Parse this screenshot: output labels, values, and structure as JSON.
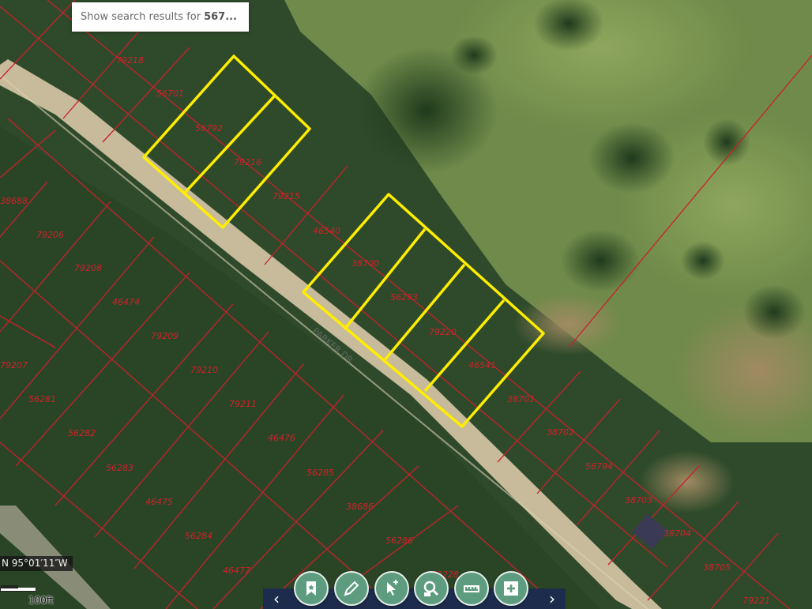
{
  "search_popup": {
    "prefix": "Show search results for",
    "query": "567..."
  },
  "coordinate_readout": "N 95°01′11″W",
  "scale_label": "100ft",
  "road_label": "PARKER DR",
  "parcel_labels": [
    "79218",
    "56701",
    "56792",
    "79216",
    "79215",
    "46540",
    "38700",
    "56293",
    "79220",
    "46541",
    "38701",
    "38702",
    "56794",
    "38703",
    "38704",
    "38705",
    "79221",
    "38688",
    "79206",
    "79208",
    "46474",
    "79209",
    "79207",
    "79210",
    "56281",
    "79211",
    "56282",
    "46476",
    "56283",
    "56285",
    "46475",
    "38686",
    "56284",
    "56286",
    "46477",
    "79228"
  ],
  "highlighted_groups": 2,
  "colors": {
    "parcel_line": "#c8202a",
    "highlight": "#ffee00",
    "toolbar": "#1d2c4d",
    "tool_button": "#5d9c7f"
  },
  "toolbar": {
    "prev": "‹",
    "next": "›",
    "buttons": [
      "bookmark-icon",
      "draw-pencil-icon",
      "identify-pointer-icon",
      "search-parcel-icon",
      "measure-icon",
      "add-icon"
    ]
  }
}
